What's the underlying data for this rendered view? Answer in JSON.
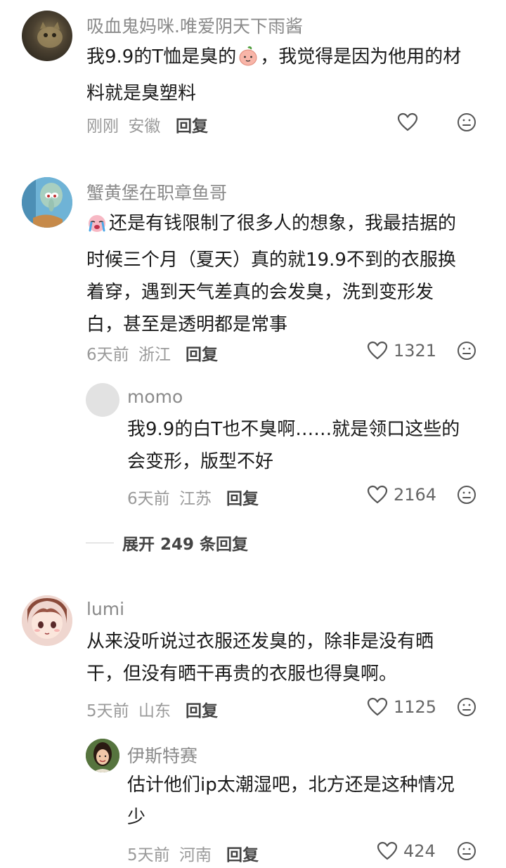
{
  "comments": [
    {
      "username": "吸血鬼妈咪.唯爱阴天下雨酱",
      "text_line1_a": "我9.9的T恤是臭的",
      "text_line1_b": "，我觉得是因为他用的材",
      "text_line2": "料就是臭塑料",
      "time": "刚刚",
      "location": "安徽",
      "reply_label": "回复"
    },
    {
      "username": "蟹黄堡在职章鱼哥",
      "text_line1": "还是有钱限制了很多人的想象，我最拮据的",
      "text_line2": "时候三个月（夏天）真的就19.9不到的衣服换",
      "text_line3": "着穿，遇到天气差真的会发臭，洗到变形发",
      "text_line4": "白，甚至是透明都是常事",
      "time": "6天前",
      "location": "浙江",
      "reply_label": "回复",
      "likes": "1321",
      "replies": [
        {
          "username": "momo",
          "text_line1": "我9.9的白T也不臭啊……就是领口这些的",
          "text_line2": "会变形，版型不好",
          "time": "6天前",
          "location": "江苏",
          "reply_label": "回复",
          "likes": "2164"
        }
      ],
      "expand_label": "展开 249 条回复"
    },
    {
      "username": "lumi",
      "text_line1": "从来没听说过衣服还发臭的，除非是没有晒",
      "text_line2": "干，但没有晒干再贵的衣服也得臭啊。",
      "time": "5天前",
      "location": "山东",
      "reply_label": "回复",
      "likes": "1125",
      "replies": [
        {
          "username": "伊斯特赛",
          "text_line1": "估计他们ip太潮湿吧，北方还是这种情况",
          "text_line2": "少",
          "time": "5天前",
          "location": "河南",
          "reply_label": "回复",
          "likes": "424"
        }
      ]
    }
  ],
  "colors": {
    "username": "#8a8a8a",
    "text": "#1a1a1a",
    "meta": "#9a9a9a"
  },
  "icons": [
    "heart-icon",
    "emoji-face-icon",
    "peach-emoji",
    "crying-emoji"
  ]
}
